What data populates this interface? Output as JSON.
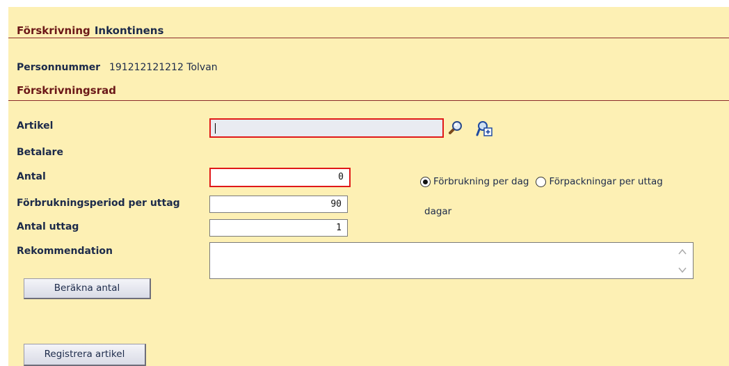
{
  "header": {
    "title": "Förskrivning",
    "subtitle": "Inkontinens"
  },
  "patient": {
    "label": "Personnummer",
    "value": "191212121212 Tolvan"
  },
  "row_section": {
    "title": "Förskrivningsrad"
  },
  "form": {
    "artikel_label": "Artikel",
    "artikel_value": "",
    "betalare_label": "Betalare",
    "antal_label": "Antal",
    "antal_value": "0",
    "period_label": "Förbrukningsperiod per uttag",
    "period_value": "90",
    "period_unit": "dagar",
    "uttag_label": "Antal uttag",
    "uttag_value": "1",
    "rekommendation_label": "Rekommendation",
    "rekommendation_value": ""
  },
  "radio": {
    "option1": "Förbrukning per dag",
    "option2": "Förpackningar per uttag",
    "selected": "option1"
  },
  "buttons": {
    "berakna": "Beräkna antal",
    "registrera": "Registrera artikel"
  },
  "icons": {
    "search": "search-icon",
    "add_search": "add-search-icon"
  },
  "colors": {
    "panel_bg": "#fdf0b4",
    "section_title": "#6b1818",
    "error_border": "#e01818"
  }
}
